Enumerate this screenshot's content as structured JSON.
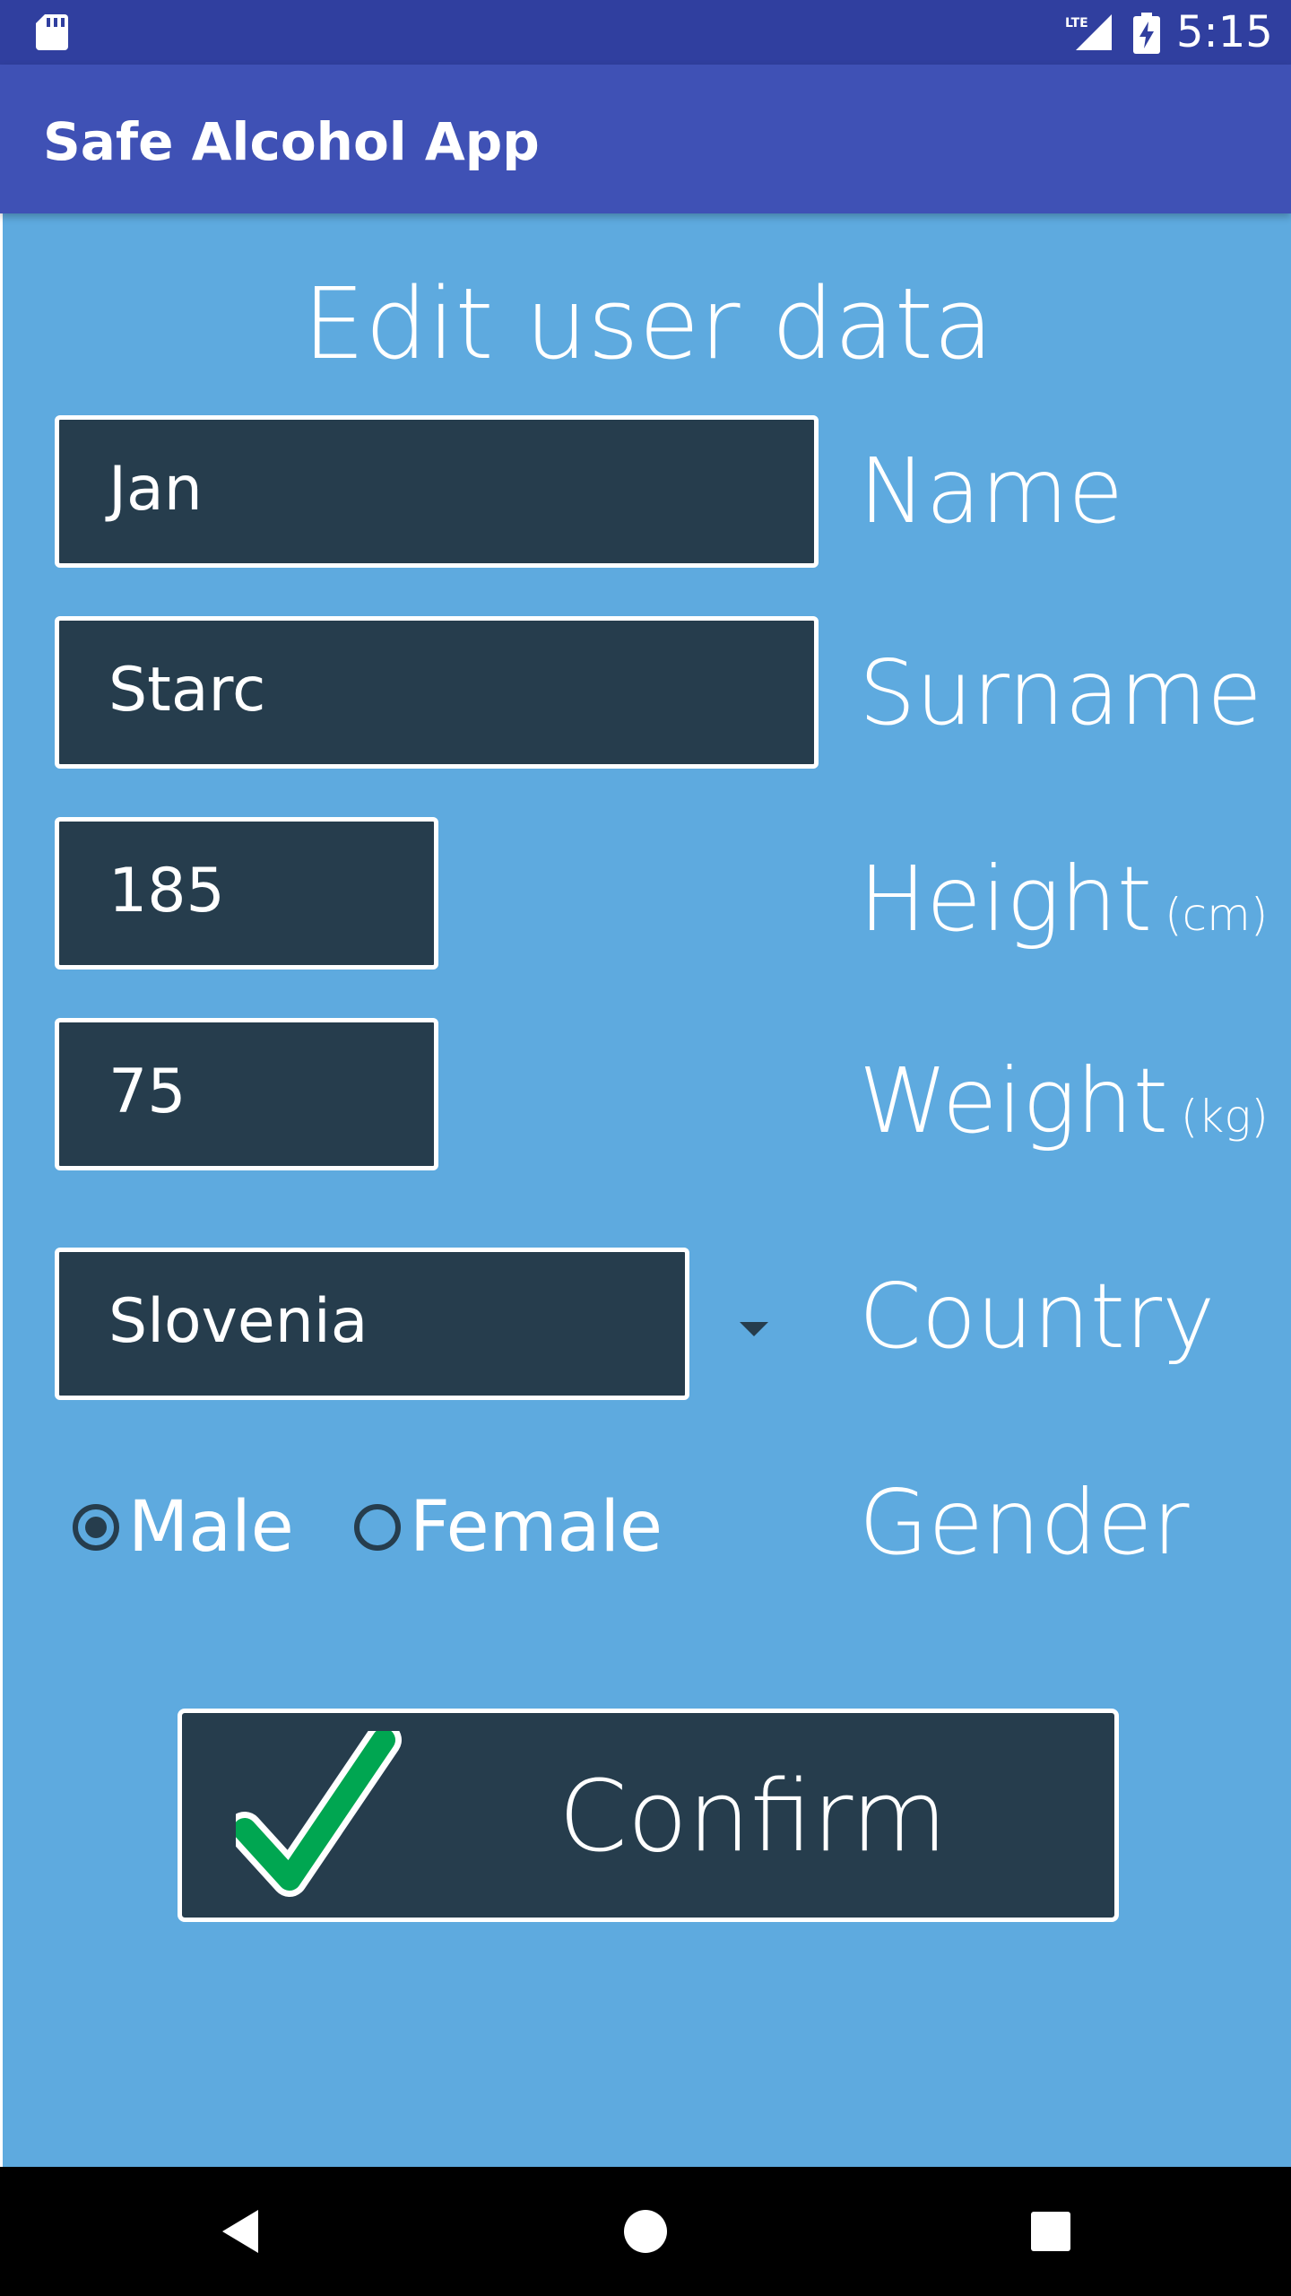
{
  "status_bar": {
    "time": "5:15",
    "icons": [
      "sd-card-icon",
      "lte-signal-icon",
      "battery-charging-icon"
    ],
    "network_label": "LTE"
  },
  "app_bar": {
    "title": "Safe Alcohol App"
  },
  "form": {
    "title": "Edit user data",
    "name": {
      "value": "Jan",
      "label": "Name"
    },
    "surname": {
      "value": "Starc",
      "label": "Surname"
    },
    "height": {
      "value": "185",
      "label": "Height",
      "unit": "(cm)"
    },
    "weight": {
      "value": "75",
      "label": "Weight",
      "unit": "(kg)"
    },
    "country": {
      "selected": "Slovenia",
      "label": "Country"
    },
    "gender": {
      "label": "Gender",
      "options": [
        {
          "label": "Male",
          "selected": true
        },
        {
          "label": "Female",
          "selected": false
        }
      ]
    },
    "confirm_button": {
      "label": "Confirm",
      "icon": "checkmark-icon"
    }
  },
  "nav_bar": {
    "icons": [
      "back-icon",
      "home-icon",
      "recents-icon"
    ]
  },
  "colors": {
    "status_bar": "#303f9f",
    "app_bar": "#3f51b5",
    "background": "#5eaadf",
    "field": "#263d4d",
    "check": "#00a651"
  }
}
